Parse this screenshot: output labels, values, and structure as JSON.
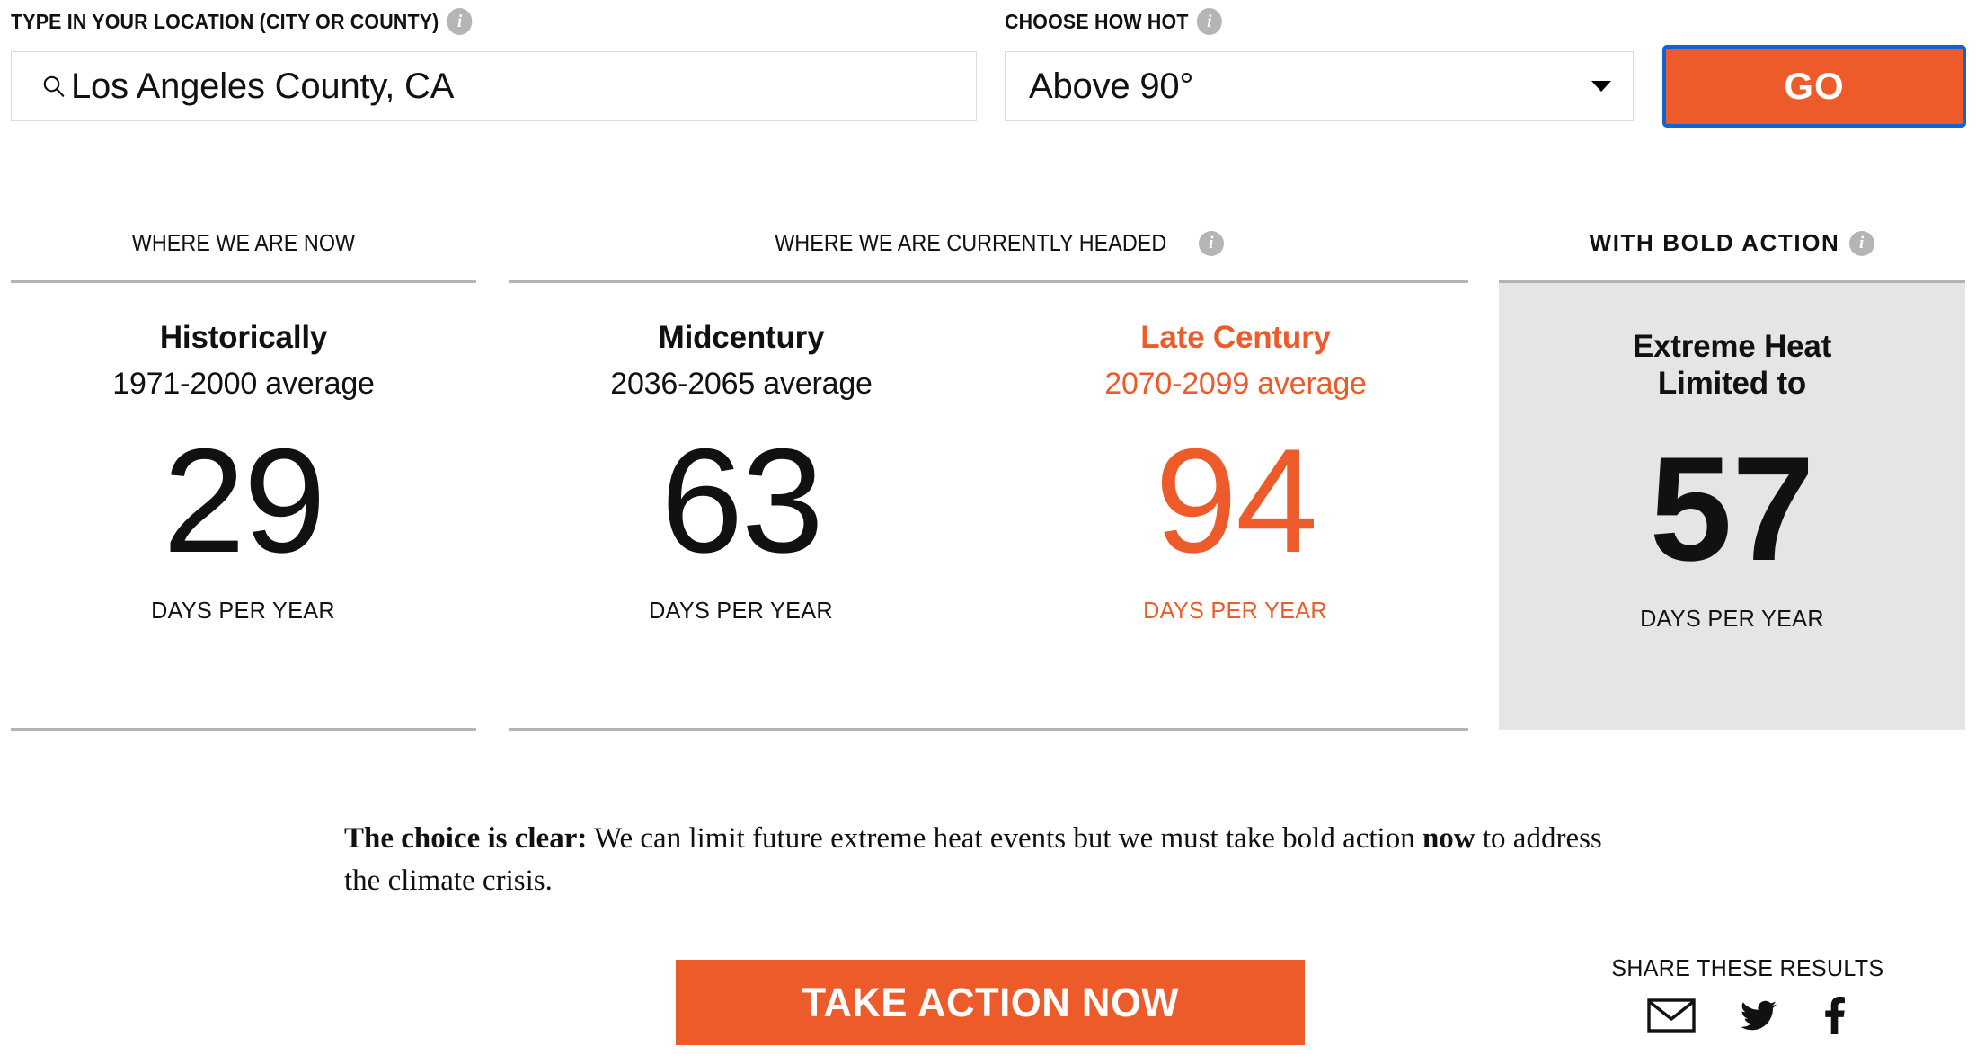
{
  "search": {
    "label": "TYPE IN YOUR LOCATION (CITY OR COUNTY)",
    "value": "Los Angeles County, CA",
    "placeholder": "Type in your location",
    "icon": "search-icon",
    "info_icon": "info-icon"
  },
  "threshold": {
    "label": "CHOOSE HOW HOT",
    "value": "Above 90°",
    "caret_icon": "chevron-down-icon",
    "info_icon": "info-icon"
  },
  "submit": {
    "label": "GO",
    "background": "#ed5b2a",
    "focus_outline": "#1263d2"
  },
  "columns": [
    {
      "header": "WHERE WE ARE NOW",
      "has_info": false
    },
    {
      "header": "WHERE WE ARE CURRENTLY HEADED",
      "has_info": true
    },
    {
      "header": "WITH BOLD ACTION",
      "has_info": true
    }
  ],
  "stats": [
    {
      "title": "Historically",
      "subtitle": "1971-2000 average",
      "value": "29",
      "unit": "DAYS PER YEAR",
      "color": "#111111"
    },
    {
      "title": "Midcentury",
      "subtitle": "2036-2065 average",
      "value": "63",
      "unit": "DAYS PER YEAR",
      "color": "#111111"
    },
    {
      "title": "Late Century",
      "subtitle": "2070-2099 average",
      "value": "94",
      "unit": "DAYS PER YEAR",
      "color": "#ed5b2a"
    },
    {
      "title_line1": "Extreme Heat",
      "title_line2": "Limited to",
      "value": "57",
      "unit": "DAYS PER YEAR",
      "color": "#111111",
      "panel_background": "#e5e5e5"
    }
  ],
  "choice": {
    "lead": "The choice is clear:",
    "body_1": " We can limit future extreme heat events but we must take bold action ",
    "emphasis": "now",
    "body_2": " to address the climate crisis."
  },
  "cta": {
    "label": "TAKE ACTION NOW",
    "background": "#ed5b2a"
  },
  "share": {
    "label": "SHARE THESE RESULTS",
    "icons": [
      "email-icon",
      "twitter-icon",
      "facebook-icon"
    ]
  },
  "theme": {
    "accent": "#ed5b2a",
    "rule": "#b4b4b4",
    "info_circle": "#b5b5b5",
    "panel_gray": "#e5e5e5"
  }
}
